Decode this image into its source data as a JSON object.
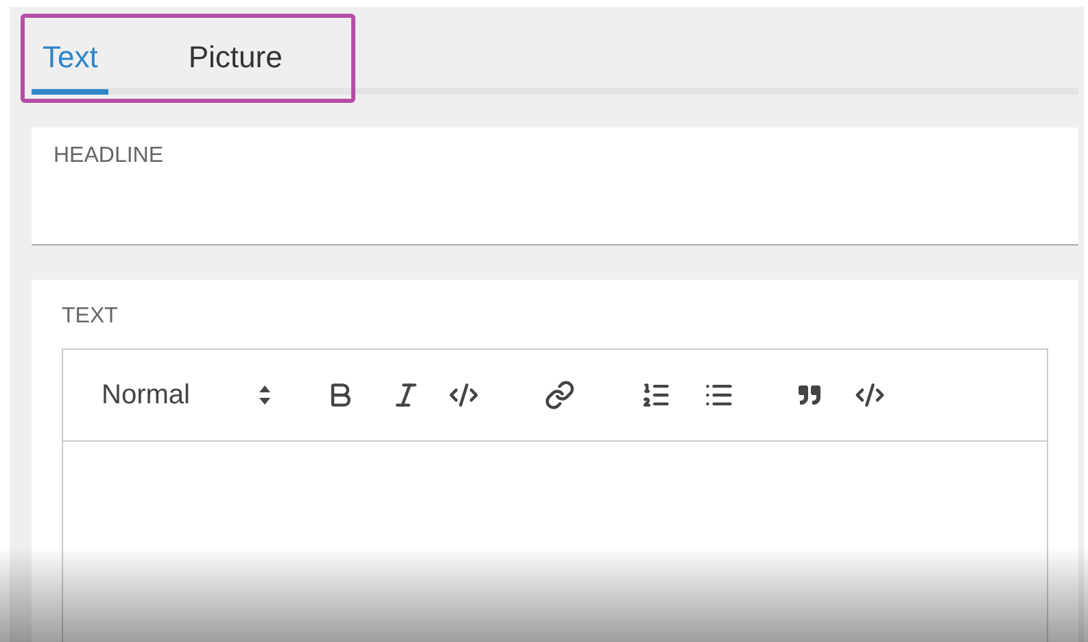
{
  "tabs": [
    {
      "label": "Text",
      "selected": true
    },
    {
      "label": "Picture",
      "selected": false
    }
  ],
  "headline": {
    "label": "HEADLINE"
  },
  "text": {
    "label": "TEXT",
    "editor": {
      "format": "Normal"
    }
  }
}
